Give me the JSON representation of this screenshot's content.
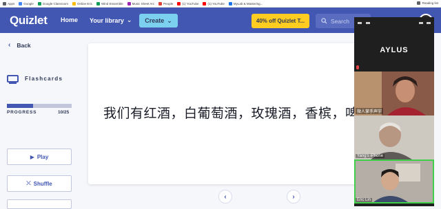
{
  "bookmarks": {
    "items": [
      {
        "label": "Apps",
        "color": "#5f6368"
      },
      {
        "label": "Google",
        "color": "#4285f4"
      },
      {
        "label": "Google Classroom",
        "color": "#0f9d58"
      },
      {
        "label": "Online Eric",
        "color": "#fbbc05"
      },
      {
        "label": "Wind Ensemble",
        "color": "#0f9d58"
      },
      {
        "label": "Music Sheet Arc",
        "color": "#9c27b0"
      },
      {
        "label": "People",
        "color": "#db4437"
      },
      {
        "label": "(1) YouTube",
        "color": "#ff0000"
      },
      {
        "label": "(1) YouTube",
        "color": "#ff0000"
      },
      {
        "label": "MyLab & Mastering...",
        "color": "#1a73e8"
      }
    ],
    "reading_list": "Reading list"
  },
  "header": {
    "logo": "Quizlet",
    "home": "Home",
    "library": "Your library",
    "create": "Create",
    "promo": "40% off Quizlet T...",
    "search_placeholder": "Search"
  },
  "sidebar": {
    "back": "Back",
    "mode_title": "Flashcards",
    "progress_label": "PROGRESS",
    "progress_count": "10/25",
    "progress_fraction": 0.4,
    "buttons": [
      {
        "label": "Play",
        "icon": "play-icon"
      },
      {
        "label": "Shuffle",
        "icon": "shuffle-icon"
      }
    ]
  },
  "card": {
    "text": "我们有红酒，白葡萄酒，玫瑰酒，香槟，啤"
  },
  "zoom": {
    "meeting_name": "AYLUS",
    "participants": [
      {
        "name": "微人掌手声宇",
        "bg": "#7a4a3a"
      },
      {
        "name": "Yang's iPhone",
        "bg": "#bdb9b3"
      },
      {
        "name": "Eric Lin",
        "bg": "#a59f98"
      }
    ],
    "active_speaker_color": "#3fcf4a"
  },
  "colors": {
    "brand": "#4257b2",
    "promo": "#ffcd1f",
    "create": "#7cd0ef"
  }
}
